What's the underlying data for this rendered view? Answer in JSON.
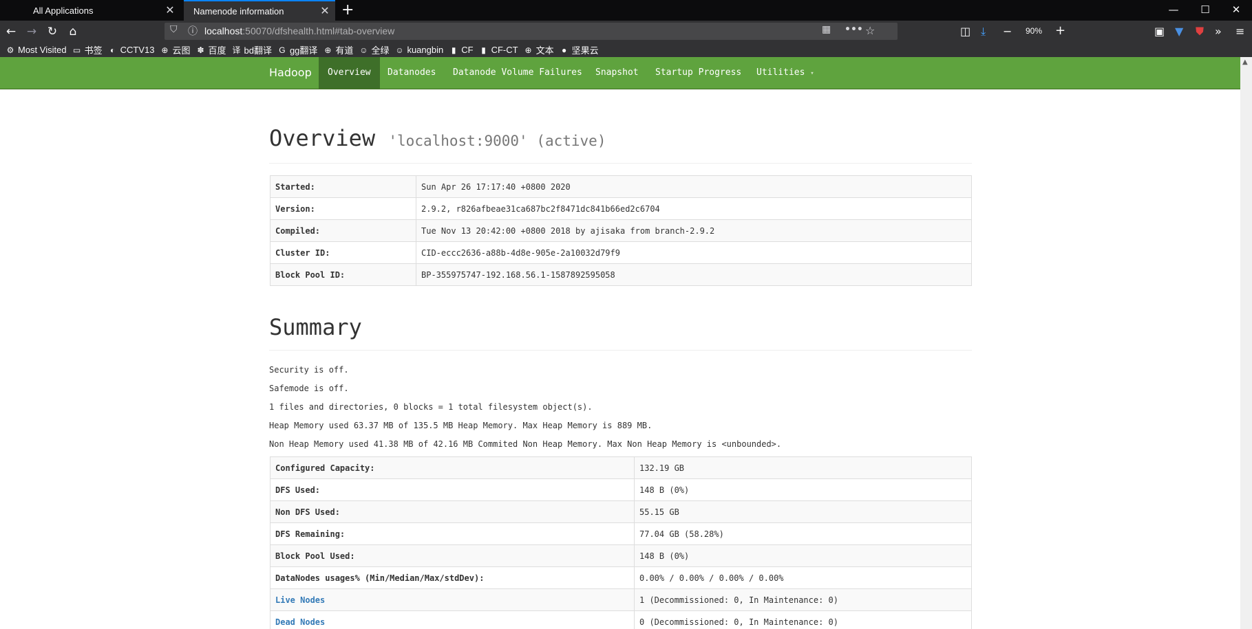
{
  "browser": {
    "tabs": [
      {
        "title": "All Applications"
      },
      {
        "title": "Namenode information"
      }
    ],
    "url": {
      "host": "localhost",
      "rest": ":50070/dfshealth.html#tab-overview"
    },
    "zoom": "90%",
    "bookmarks": [
      {
        "label": "Most Visited",
        "icon": "gear-icon"
      },
      {
        "label": "书签",
        "icon": "folder-icon"
      },
      {
        "label": "CCTV13",
        "icon": "cctv-icon"
      },
      {
        "label": "云图",
        "icon": "globe-icon"
      },
      {
        "label": "百度",
        "icon": "baidu-icon"
      },
      {
        "label": "bd翻译",
        "icon": "translate-icon"
      },
      {
        "label": "gg翻译",
        "icon": "google-translate-icon"
      },
      {
        "label": "有道",
        "icon": "globe-icon"
      },
      {
        "label": "全绿",
        "icon": "face-icon"
      },
      {
        "label": "kuangbin",
        "icon": "face-icon"
      },
      {
        "label": "CF",
        "icon": "bars-icon"
      },
      {
        "label": "CF-CT",
        "icon": "bars-icon"
      },
      {
        "label": "文本",
        "icon": "globe-icon"
      },
      {
        "label": "坚果云",
        "icon": "nut-icon"
      }
    ]
  },
  "nav": {
    "brand": "Hadoop",
    "items": [
      "Overview",
      "Datanodes",
      "Datanode Volume Failures",
      "Snapshot",
      "Startup Progress",
      "Utilities"
    ]
  },
  "overview": {
    "title": "Overview",
    "subtitle": "'localhost:9000' (active)",
    "rows": [
      {
        "k": "Started:",
        "v": "Sun Apr 26 17:17:40 +0800 2020"
      },
      {
        "k": "Version:",
        "v": "2.9.2, r826afbeae31ca687bc2f8471dc841b66ed2c6704"
      },
      {
        "k": "Compiled:",
        "v": "Tue Nov 13 20:42:00 +0800 2018 by ajisaka from branch-2.9.2"
      },
      {
        "k": "Cluster ID:",
        "v": "CID-eccc2636-a88b-4d8e-905e-2a10032d79f9"
      },
      {
        "k": "Block Pool ID:",
        "v": "BP-355975747-192.168.56.1-1587892595058"
      }
    ]
  },
  "summary": {
    "title": "Summary",
    "lines": [
      "Security is off.",
      "Safemode is off.",
      "1 files and directories, 0 blocks = 1 total filesystem object(s).",
      "Heap Memory used 63.37 MB of 135.5 MB Heap Memory. Max Heap Memory is 889 MB.",
      "Non Heap Memory used 41.38 MB of 42.16 MB Commited Non Heap Memory. Max Non Heap Memory is <unbounded>."
    ],
    "rows": [
      {
        "k": "Configured Capacity:",
        "v": "132.19 GB"
      },
      {
        "k": "DFS Used:",
        "v": "148 B (0%)"
      },
      {
        "k": "Non DFS Used:",
        "v": "55.15 GB"
      },
      {
        "k": "DFS Remaining:",
        "v": "77.04 GB (58.28%)"
      },
      {
        "k": "Block Pool Used:",
        "v": "148 B (0%)"
      },
      {
        "k": "DataNodes usages% (Min/Median/Max/stdDev):",
        "v": "0.00% / 0.00% / 0.00% / 0.00%"
      },
      {
        "k": "Live Nodes",
        "v": "1 (Decommissioned: 0, In Maintenance: 0)"
      },
      {
        "k": "Dead Nodes",
        "v": "0 (Decommissioned: 0, In Maintenance: 0)"
      }
    ]
  },
  "colors": {
    "nav_bg": "#5fa33e",
    "nav_active": "#3e6f29",
    "link": "#337ab7"
  }
}
